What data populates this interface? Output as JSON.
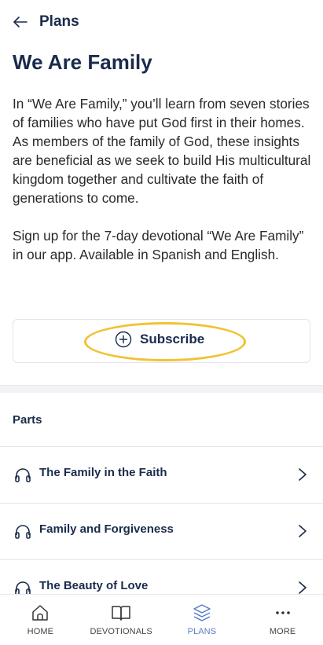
{
  "header": {
    "back_label": "Plans"
  },
  "plan": {
    "title": "We Are Family",
    "description_1": "In “We Are Family,” you’ll learn from seven stories of families who have put God first in their homes. As members of the family of God, these insights are beneficial as we seek to build His multicultural kingdom together and cultivate the faith of generations to come.",
    "description_2": "Sign up for the 7-day devotional “We Are Family” in our app. Available in Spanish and English.",
    "subscribe_label": "Subscribe"
  },
  "parts": {
    "header": "Parts",
    "items": [
      {
        "title": "The Family in the Faith",
        "icon": "headphones-icon"
      },
      {
        "title": "Family and Forgiveness",
        "icon": "headphones-icon"
      },
      {
        "title": "The Beauty of Love",
        "icon": "headphones-icon"
      }
    ]
  },
  "nav": {
    "items": [
      {
        "label": "HOME",
        "icon": "home-icon",
        "active": false
      },
      {
        "label": "DEVOTIONALS",
        "icon": "book-icon",
        "active": false
      },
      {
        "label": "PLANS",
        "icon": "layers-icon",
        "active": true
      },
      {
        "label": "MORE",
        "icon": "more-icon",
        "active": false
      }
    ]
  },
  "colors": {
    "primary_text": "#1a2b4c",
    "active_nav": "#5b7dc8",
    "highlight": "#f1c232"
  }
}
